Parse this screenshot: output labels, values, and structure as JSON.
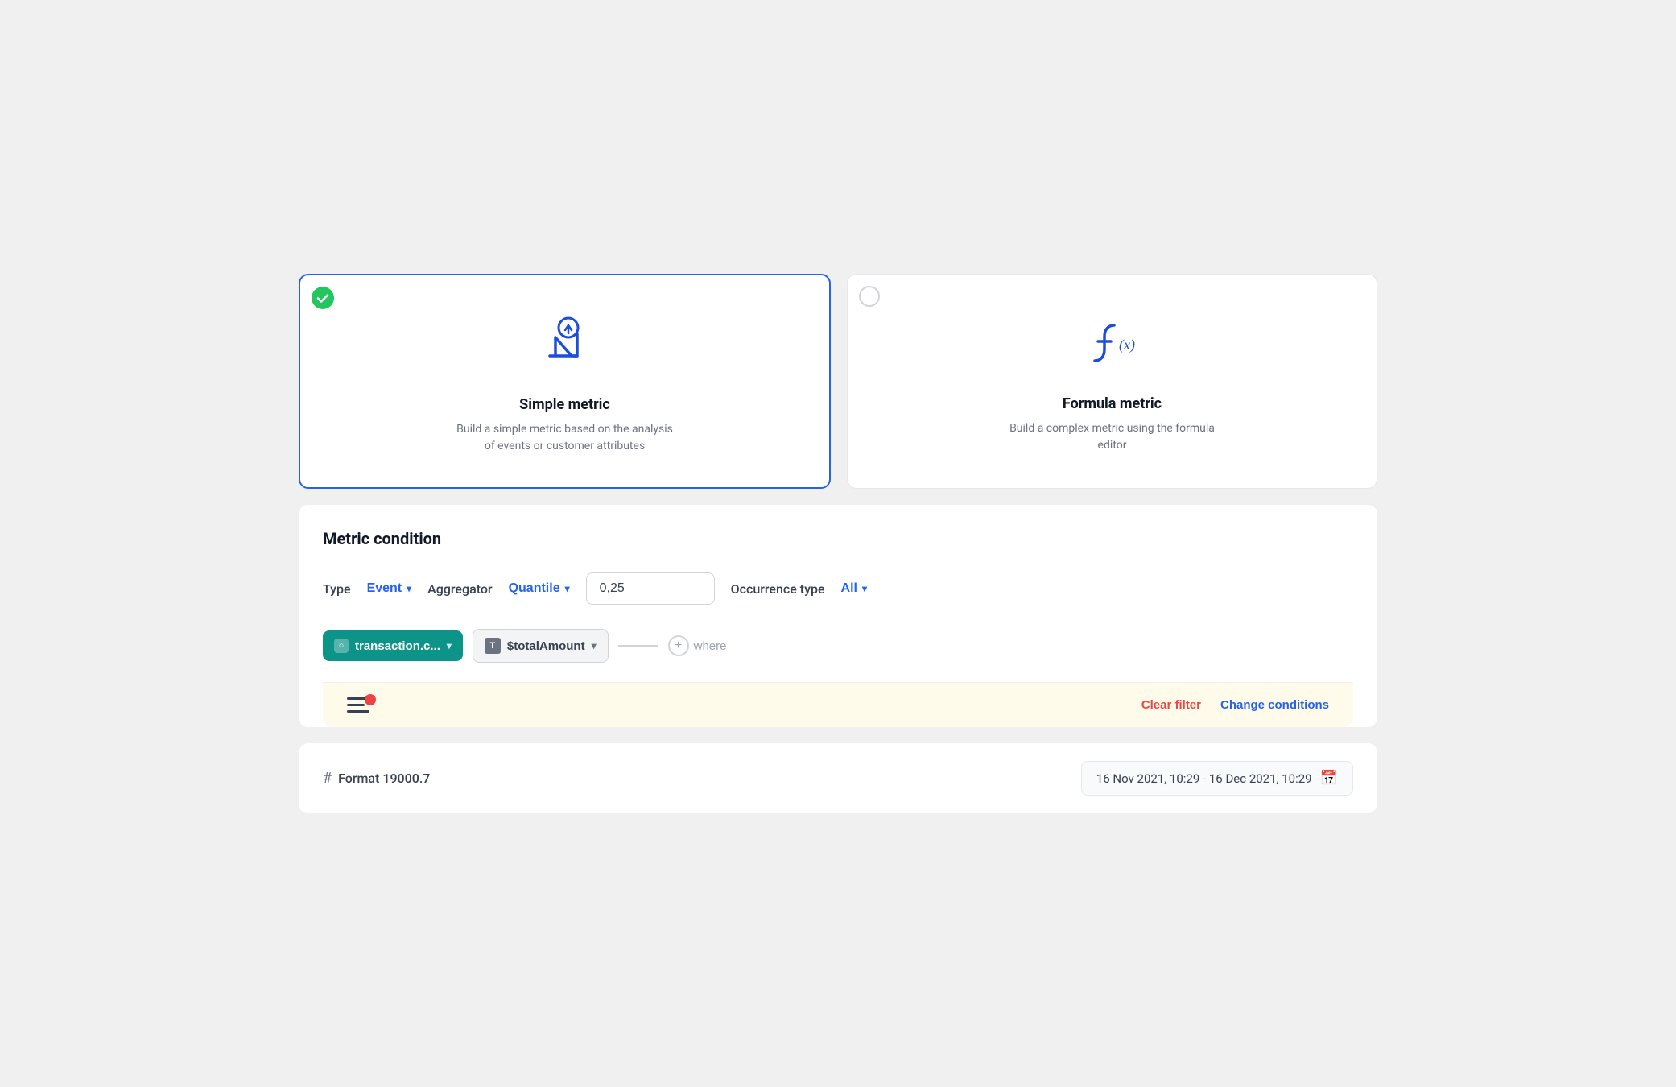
{
  "metric_types": {
    "simple": {
      "title": "Simple metric",
      "description": "Build a simple metric based on the analysis of events or customer attributes",
      "selected": true
    },
    "formula": {
      "title": "Formula metric",
      "description": "Build a complex metric using the formula editor",
      "selected": false
    }
  },
  "metric_condition": {
    "section_title": "Metric condition",
    "type_label": "Type",
    "type_value": "Event",
    "aggregator_label": "Aggregator",
    "aggregator_value": "Quantile",
    "quantile_value": "0,25",
    "occurrence_type_label": "Occurrence type",
    "occurrence_type_value": "All"
  },
  "filter": {
    "event_name": "transaction.c...",
    "field_name": "$totalAmount",
    "where_label": "where"
  },
  "alert": {
    "clear_filter_label": "Clear filter",
    "change_conditions_label": "Change conditions"
  },
  "footer": {
    "format_hash": "#",
    "format_label": "Format 19000.7",
    "date_range": "16 Nov 2021, 10:29 - 16 Dec 2021, 10:29"
  }
}
